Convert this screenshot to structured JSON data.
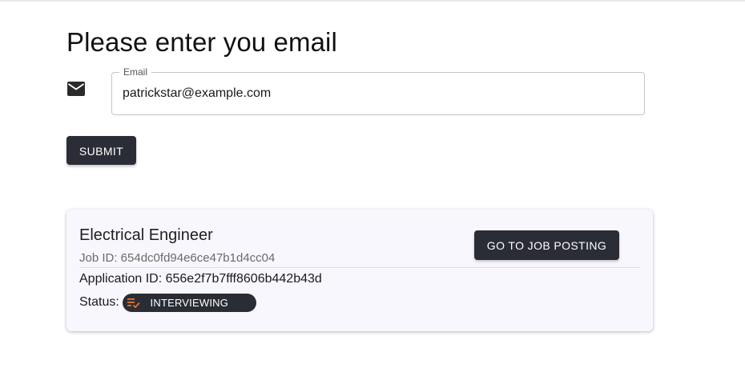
{
  "page": {
    "title": "Please enter you email"
  },
  "email_form": {
    "icon": "mail-icon",
    "label": "Email",
    "value": "patrickstar@example.com",
    "submit_label": "SUBMIT"
  },
  "job_card": {
    "title": "Electrical Engineer",
    "job_id_text": "Job ID: 654dc0fd94e6ce47b1d4cc04",
    "goto_label": "GO TO JOB POSTING",
    "application_id_text": "Application ID: 656e2f7b7fff8606b442b43d",
    "status_label": "Status:",
    "status_value": "INTERVIEWING",
    "status_icon": "checklist-icon",
    "status_icon_color": "#e8742c"
  },
  "colors": {
    "button_bg": "#2b2d36",
    "card_bg": "#f8f7fe"
  }
}
